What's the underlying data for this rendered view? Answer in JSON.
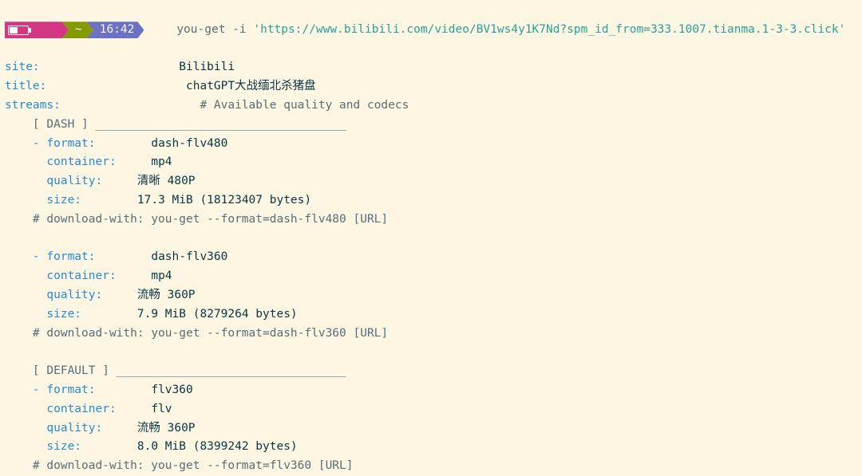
{
  "prompt": {
    "path": "~",
    "time": "16:42",
    "command": "you-get",
    "flag": "-i",
    "url": "'https://www.bilibili.com/video/BV1ws4y1K7Nd?spm_id_from=333.1007.tianma.1-3-3.click'"
  },
  "info": {
    "site_label": "site:",
    "site_value": "Bilibili",
    "title_label": "title:",
    "title_value": "chatGPT大战缅北杀猪盘",
    "streams_label": "streams:",
    "streams_value": "# Available quality and codecs"
  },
  "dash_header": "    [ DASH ] ____________________________________",
  "dash": [
    {
      "format_label": "    - format:",
      "format_value": "dash-flv480",
      "container_label": "      container:",
      "container_value": "mp4",
      "quality_label": "      quality:",
      "quality_value": "清晰 480P",
      "size_label": "      size:",
      "size_value": "17.3 MiB (18123407 bytes)",
      "download_with": "    # download-with: you-get --format=dash-flv480 [URL]"
    },
    {
      "format_label": "    - format:",
      "format_value": "dash-flv360",
      "container_label": "      container:",
      "container_value": "mp4",
      "quality_label": "      quality:",
      "quality_value": "流畅 360P",
      "size_label": "      size:",
      "size_value": "7.9 MiB (8279264 bytes)",
      "download_with": "    # download-with: you-get --format=dash-flv360 [URL]"
    }
  ],
  "default_header": "    [ DEFAULT ] _________________________________",
  "default": [
    {
      "format_label": "    - format:",
      "format_value": "flv360",
      "container_label": "      container:",
      "container_value": "flv",
      "quality_label": "      quality:",
      "quality_value": "流畅 360P",
      "size_label": "      size:",
      "size_value": "8.0 MiB (8399242 bytes)",
      "download_with": "    # download-with: you-get --format=flv360 [URL]"
    }
  ],
  "p20": "                    ",
  "p13": "        ",
  "p10": "     ",
  "p7": "     ",
  "p8": "        ",
  "blank": ""
}
